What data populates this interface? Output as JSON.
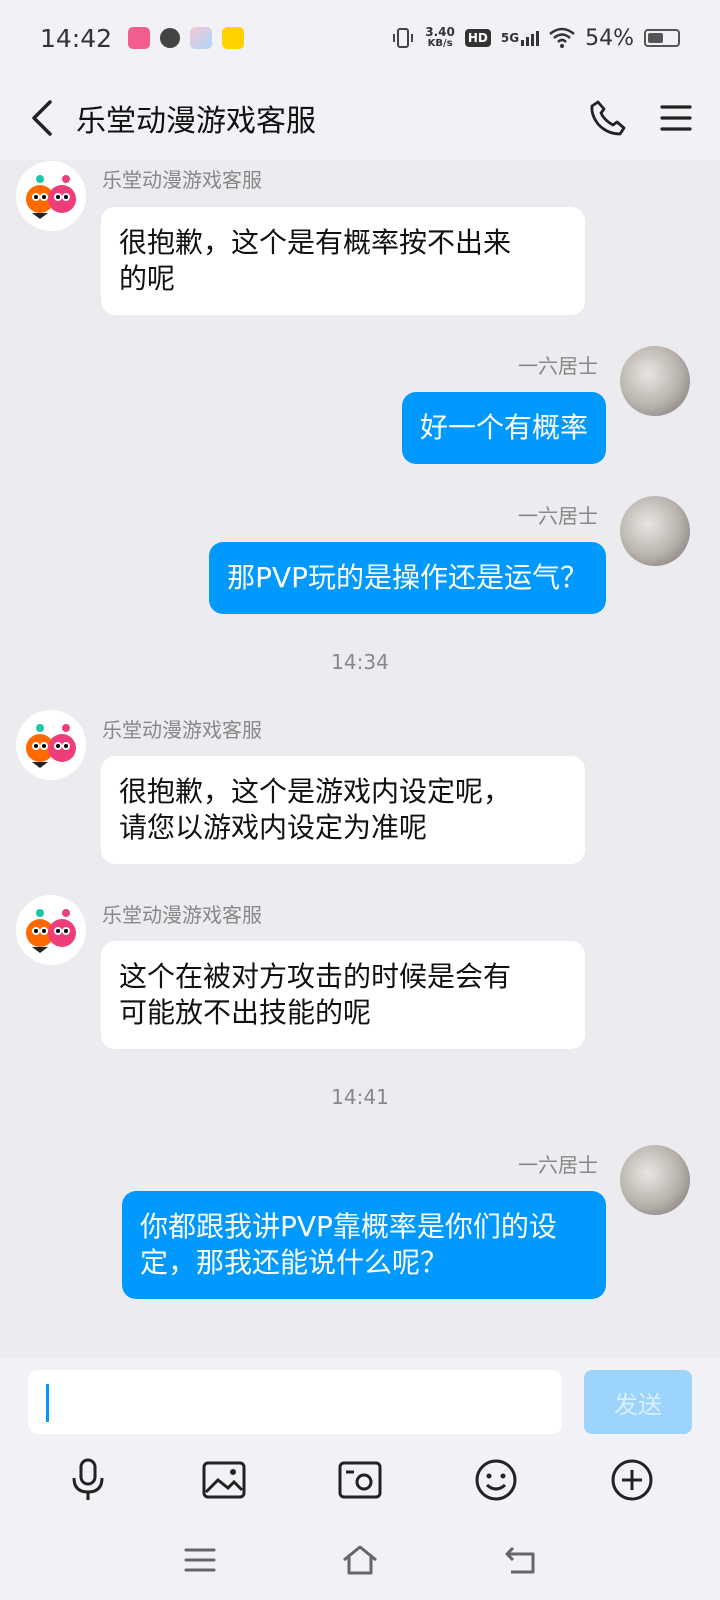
{
  "status_bar": {
    "time": "14:42",
    "net_speed_value": "3.40",
    "net_speed_unit": "KB/s",
    "hd": "HD",
    "network": "5G",
    "battery": "54%",
    "battery_level": 0.54
  },
  "header": {
    "title": "乐堂动漫游戏客服"
  },
  "messages": [
    {
      "type": "in",
      "sender": "乐堂动漫游戏客服",
      "lines": [
        "很抱歉，这个是有概率按不出来",
        "的呢"
      ]
    },
    {
      "type": "out",
      "sender": "一六居士",
      "lines": [
        "好一个有概率"
      ]
    },
    {
      "type": "out",
      "sender": "一六居士",
      "lines": [
        "那PVP玩的是操作还是运气？"
      ]
    },
    {
      "type": "time",
      "text": "14:34"
    },
    {
      "type": "in",
      "sender": "乐堂动漫游戏客服",
      "lines": [
        "很抱歉，这个是游戏内设定呢，",
        "请您以游戏内设定为准呢"
      ]
    },
    {
      "type": "in",
      "sender": "乐堂动漫游戏客服",
      "lines": [
        "这个在被对方攻击的时候是会有",
        "可能放不出技能的呢"
      ]
    },
    {
      "type": "time",
      "text": "14:41"
    },
    {
      "type": "out",
      "sender": "一六居士",
      "lines": [
        "你都跟我讲PVP靠概率是你们的设",
        "定，那我还能说什么呢？"
      ]
    }
  ],
  "input": {
    "value": "",
    "send_label": "发送"
  },
  "colors": {
    "accent": "#0099ff",
    "send_disabled": "#9dd4fb"
  }
}
